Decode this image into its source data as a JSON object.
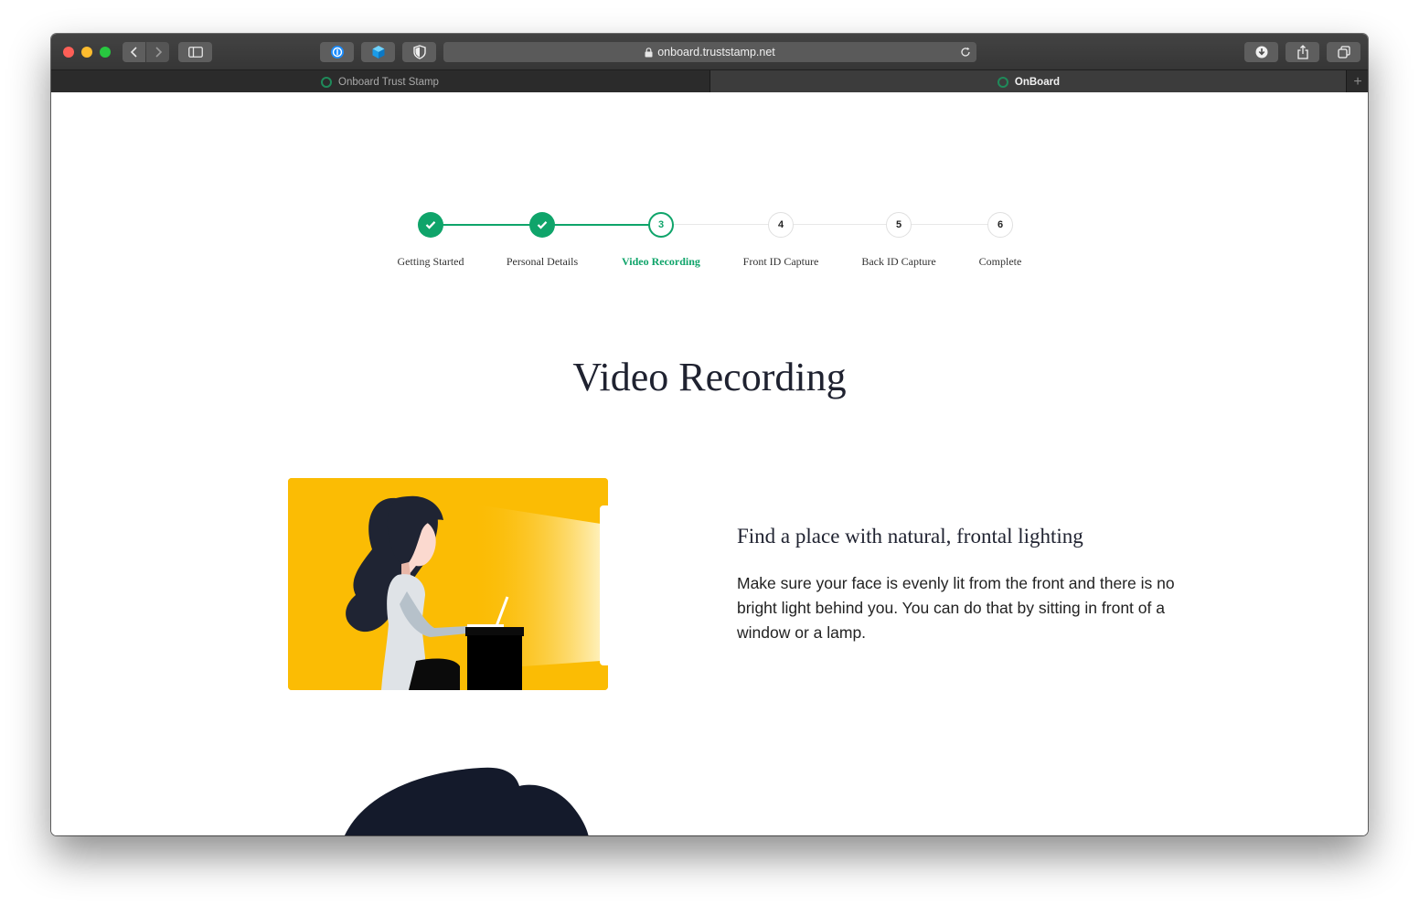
{
  "browser": {
    "url": "onboard.truststamp.net",
    "tabs": [
      {
        "label": "Onboard Trust Stamp",
        "active": false
      },
      {
        "label": "OnBoard",
        "active": true
      }
    ],
    "new_tab_label": "+"
  },
  "stepper": {
    "accent_color": "#0fa46a",
    "steps": [
      {
        "number": "1",
        "label": "Getting Started",
        "state": "done"
      },
      {
        "number": "2",
        "label": "Personal Details",
        "state": "done"
      },
      {
        "number": "3",
        "label": "Video Recording",
        "state": "current"
      },
      {
        "number": "4",
        "label": "Front ID Capture",
        "state": "todo"
      },
      {
        "number": "5",
        "label": "Back ID Capture",
        "state": "todo"
      },
      {
        "number": "6",
        "label": "Complete",
        "state": "todo"
      }
    ]
  },
  "page": {
    "title": "Video Recording",
    "tip": {
      "title": "Find a place with natural, frontal lighting",
      "text": "Make sure your face is evenly lit from the front and there is no bright light behind you. You can do that by sitting in front of a window or a lamp."
    }
  },
  "icons": {
    "check": "check-icon",
    "lock": "lock-icon",
    "reload": "reload-icon"
  }
}
